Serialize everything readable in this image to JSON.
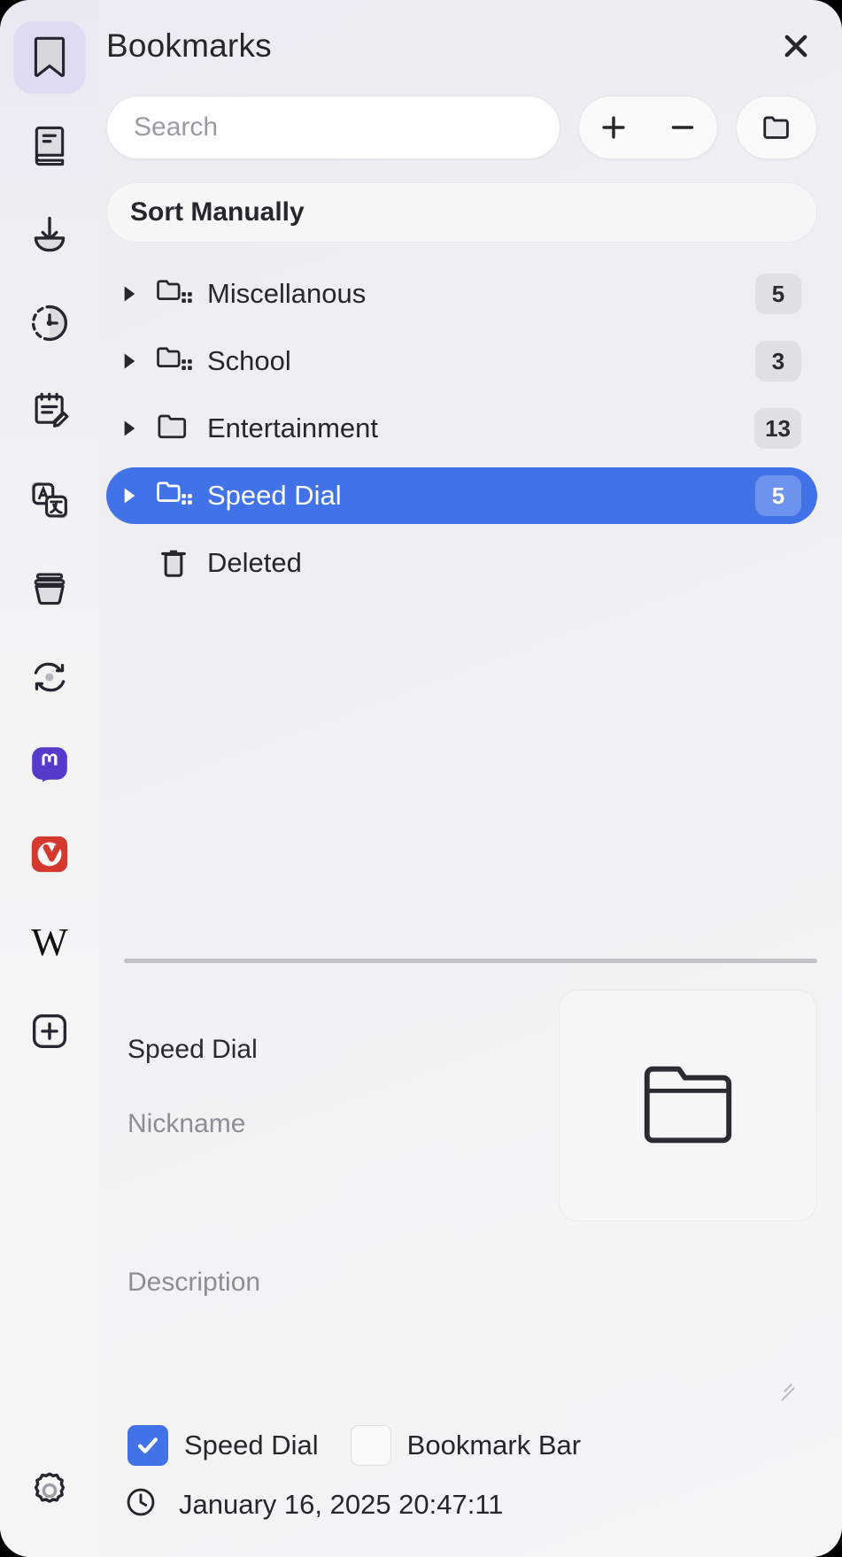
{
  "window": {
    "panel_title": "Bookmarks",
    "close_label": "Close panel",
    "accent_color": "#4272e8",
    "badge_color": "#e0e0e4"
  },
  "rail": {
    "items": [
      {
        "name": "bookmarks",
        "icon": "bookmark-icon",
        "active": true
      },
      {
        "name": "reading-list",
        "icon": "reading-list-icon",
        "active": false
      },
      {
        "name": "downloads",
        "icon": "download-icon",
        "active": false
      },
      {
        "name": "history",
        "icon": "history-clock-icon",
        "active": false
      },
      {
        "name": "notes",
        "icon": "notes-edit-icon",
        "active": false
      },
      {
        "name": "translate",
        "icon": "translate-icon",
        "active": false
      },
      {
        "name": "window",
        "icon": "window-basket-icon",
        "active": false
      },
      {
        "name": "sync",
        "icon": "sync-arrows-icon",
        "active": false
      },
      {
        "name": "mastodon",
        "icon": "mastodon-icon",
        "active": false
      },
      {
        "name": "vivaldi",
        "icon": "vivaldi-icon",
        "active": false
      },
      {
        "name": "wikipedia",
        "icon": "wikipedia-w-icon",
        "active": false
      },
      {
        "name": "add-web-panel",
        "icon": "plus-square-icon",
        "active": false
      }
    ],
    "settings": {
      "name": "settings",
      "icon": "gear-icon"
    }
  },
  "toolbar": {
    "search_placeholder": "Search",
    "search_value": "",
    "add_label": "+",
    "remove_label": "−",
    "new_folder_label": "New Folder"
  },
  "sort": {
    "label": "Sort Manually"
  },
  "tree": {
    "rows": [
      {
        "label": "Miscellanous",
        "count": "5",
        "icon": "speeddial-folder-icon",
        "expandable": true,
        "selected": false
      },
      {
        "label": "School",
        "count": "3",
        "icon": "speeddial-folder-icon",
        "expandable": true,
        "selected": false
      },
      {
        "label": "Entertainment",
        "count": "13",
        "icon": "folder-icon",
        "expandable": true,
        "selected": false
      },
      {
        "label": "Speed Dial",
        "count": "5",
        "icon": "speeddial-folder-icon",
        "expandable": true,
        "selected": true
      },
      {
        "label": "Deleted",
        "count": "",
        "icon": "trash-icon",
        "expandable": false,
        "selected": false
      }
    ]
  },
  "detail": {
    "title_value": "Speed Dial",
    "title_placeholder": "Title",
    "nickname_value": "",
    "nickname_placeholder": "Nickname",
    "description_value": "",
    "description_placeholder": "Description",
    "thumbnail_icon": "folder-icon",
    "speed_dial": {
      "label": "Speed Dial",
      "checked": true
    },
    "bookmark_bar": {
      "label": "Bookmark Bar",
      "checked": false
    },
    "date_icon": "clock-icon",
    "date_text": "January 16, 2025 20:47:11"
  }
}
